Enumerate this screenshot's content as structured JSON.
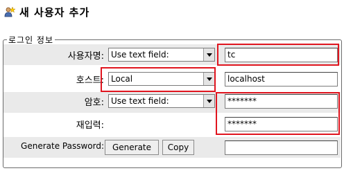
{
  "header": {
    "title": "새 사용자 추가",
    "icon": "add-user-icon"
  },
  "login_info": {
    "legend": "로그인 정보",
    "username": {
      "label": "사용자명:",
      "option": "Use text field:",
      "value": "tc"
    },
    "host": {
      "label": "호스트:",
      "option": "Local",
      "value": "localhost"
    },
    "password": {
      "label": "암호:",
      "option": "Use text field:",
      "value": "*******"
    },
    "retype": {
      "label": "재입력:",
      "value": "*******"
    },
    "generate": {
      "label": "Generate Password:",
      "generate_button": "Generate",
      "copy_button": "Copy",
      "value": ""
    }
  },
  "colors": {
    "highlight": "#e0141e",
    "row_alt": "#eaeaea"
  }
}
